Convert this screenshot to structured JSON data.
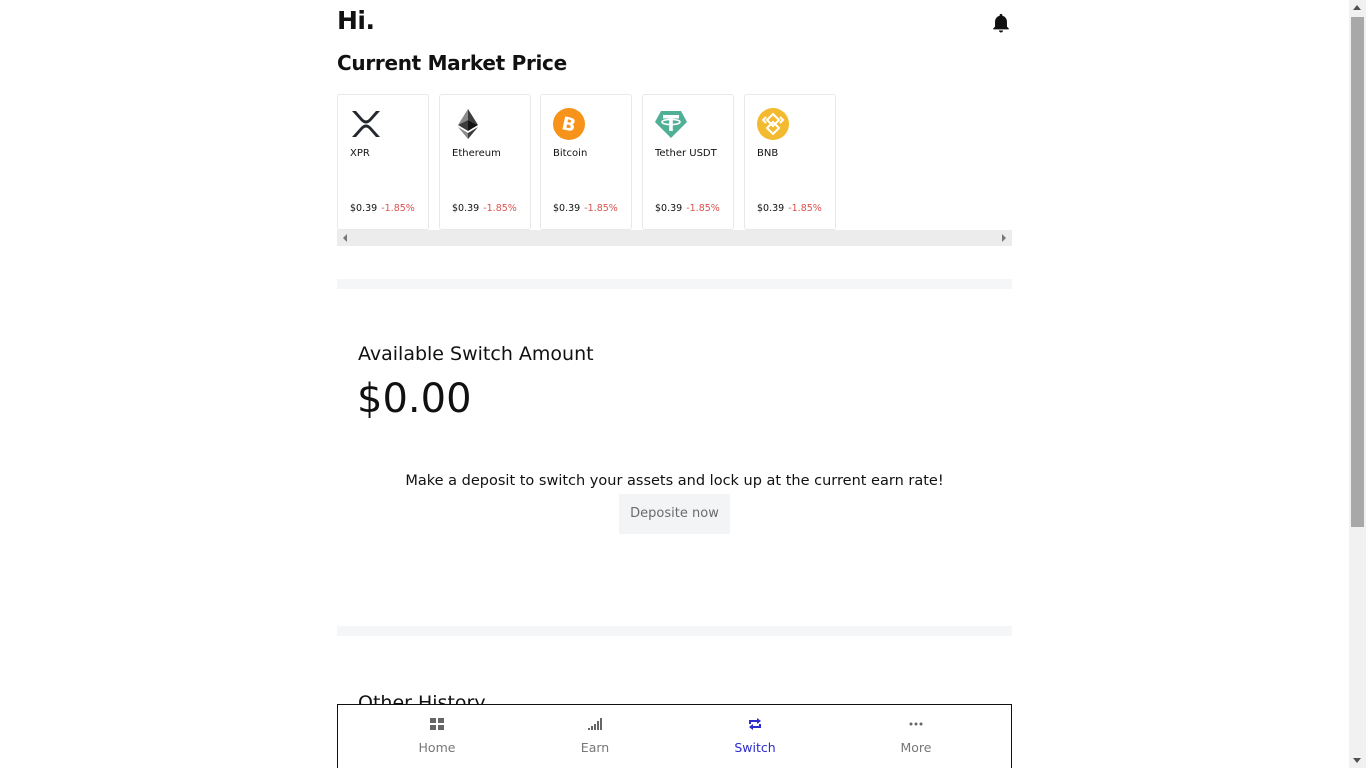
{
  "header": {
    "greeting": "Hi.",
    "notification_icon": "bell-icon"
  },
  "market": {
    "title": "Current Market Price",
    "coins": [
      {
        "name": "XPR",
        "icon": "xrp-icon",
        "price": "$0.39",
        "change": "-1.85%"
      },
      {
        "name": "Ethereum",
        "icon": "ethereum-icon",
        "price": "$0.39",
        "change": "-1.85%"
      },
      {
        "name": "Bitcoin",
        "icon": "bitcoin-icon",
        "price": "$0.39",
        "change": "-1.85%"
      },
      {
        "name": "Tether USDT",
        "icon": "tether-icon",
        "price": "$0.39",
        "change": "-1.85%"
      },
      {
        "name": "BNB",
        "icon": "bnb-icon",
        "price": "$0.39",
        "change": "-1.85%"
      }
    ],
    "negative_color": "#d9534f"
  },
  "switch": {
    "label": "Available Switch Amount",
    "amount": "$0.00",
    "message": "Make a deposit to switch your assets and lock up at the current earn rate!",
    "button_label": "Deposite now"
  },
  "history": {
    "title": "Other History"
  },
  "nav": {
    "items": [
      {
        "label": "Home",
        "icon": "grid-icon"
      },
      {
        "label": "Earn",
        "icon": "signal-bars-icon"
      },
      {
        "label": "Switch",
        "icon": "switch-arrows-icon",
        "active": true
      },
      {
        "label": "More",
        "icon": "more-dots-icon"
      }
    ],
    "active_color": "#2c2ccf",
    "inactive_color": "#777777"
  }
}
